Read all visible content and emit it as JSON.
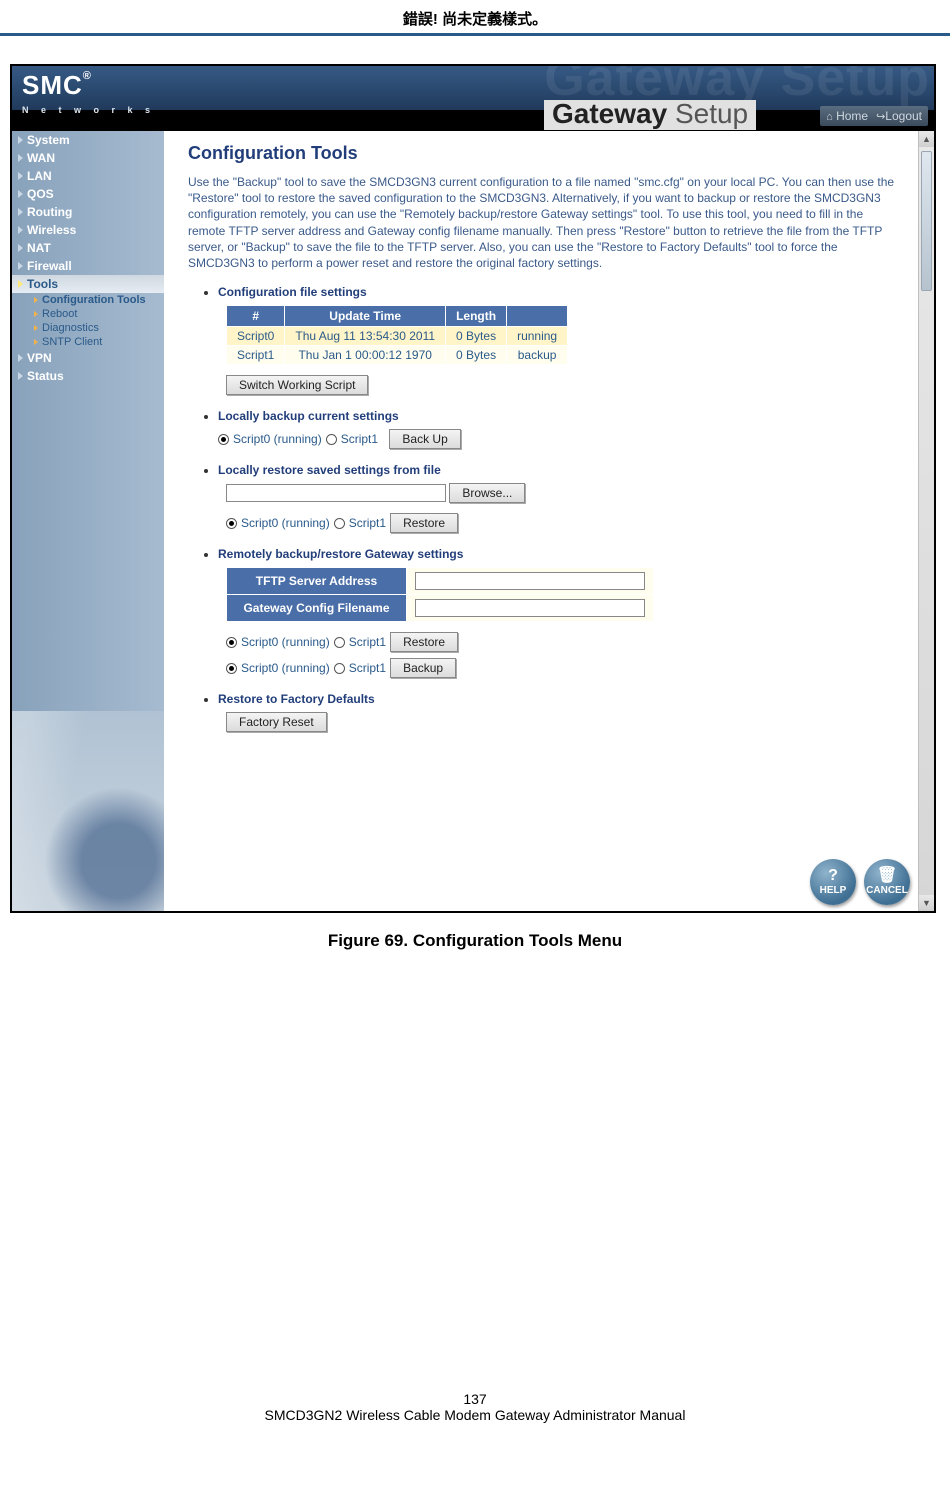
{
  "doc_header": "錯誤! 尚未定義樣式。",
  "branding": {
    "logo_main": "SMC",
    "logo_reg": "®",
    "logo_sub": "N e t w o r k s",
    "ghost": "Gateway Setup",
    "title_a": "Gateway",
    "title_b": " Setup",
    "home": "Home",
    "logout": "Logout"
  },
  "sidebar": {
    "groups": [
      {
        "label": "System"
      },
      {
        "label": "WAN"
      },
      {
        "label": "LAN"
      },
      {
        "label": "QOS"
      },
      {
        "label": "Routing"
      },
      {
        "label": "Wireless"
      },
      {
        "label": "NAT"
      },
      {
        "label": "Firewall"
      },
      {
        "label": "Tools",
        "active": true
      },
      {
        "label": "VPN"
      },
      {
        "label": "Status"
      }
    ],
    "tools_sub": [
      {
        "label": "Configuration Tools",
        "sel": true
      },
      {
        "label": "Reboot"
      },
      {
        "label": "Diagnostics"
      },
      {
        "label": "SNTP Client"
      }
    ]
  },
  "content": {
    "title": "Configuration Tools",
    "intro": "Use the \"Backup\" tool to save the SMCD3GN3 current configuration to a file named \"smc.cfg\" on your local PC. You can then use the \"Restore\" tool to restore the saved configuration to the SMCD3GN3. Alternatively, if you want to backup or restore the SMCD3GN3 configuration remotely, you can use the \"Remotely backup/restore Gateway settings\" tool. To use this tool, you need to fill in the remote TFTP server address and Gateway config filename manually. Then press \"Restore\" button to retrieve the file from the TFTP server, or \"Backup\" to save the file to the TFTP server. Also, you can use the \"Restore to Factory Defaults\" tool to force the SMCD3GN3 to perform a power reset and restore the original factory settings.",
    "feat1": "Configuration file settings",
    "cfg_table": {
      "headers": [
        "#",
        "Update Time",
        "Length",
        ""
      ],
      "rows": [
        [
          "Script0",
          "Thu Aug 11 13:54:30 2011",
          "0 Bytes",
          "running"
        ],
        [
          "Script1",
          "Thu Jan 1 00:00:12 1970",
          "0 Bytes",
          "backup"
        ]
      ]
    },
    "switch_btn": "Switch Working Script",
    "feat2": "Locally backup current settings",
    "radio_a0": "Script0 (running)",
    "radio_a1": "Script1",
    "backup_btn": "Back Up",
    "feat3": "Locally restore saved settings from file",
    "browse_btn": "Browse...",
    "restore_btn": "Restore",
    "feat4": "Remotely backup/restore Gateway settings",
    "tftp_h0": "TFTP Server Address",
    "tftp_h1": "Gateway Config Filename",
    "remote_restore_btn": "Restore",
    "remote_backup_btn": "Backup",
    "feat5": "Restore to Factory Defaults",
    "factory_btn": "Factory Reset",
    "help_label": "HELP",
    "cancel_label": "CANCEL"
  },
  "caption": "Figure 69. Configuration Tools Menu",
  "footer": {
    "page_no": "137",
    "manual": "SMCD3GN2 Wireless Cable Modem Gateway Administrator Manual"
  }
}
